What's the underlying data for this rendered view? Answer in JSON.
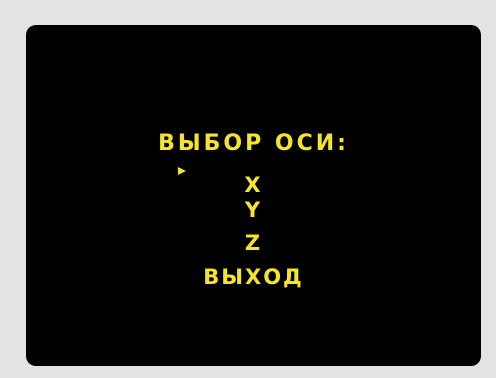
{
  "menu": {
    "title": "ВЫБОР ОСИ:",
    "items": [
      {
        "label": "X",
        "selected": true
      },
      {
        "label": "Y",
        "selected": false
      },
      {
        "label": "Z",
        "selected": false
      },
      {
        "label": "ВЫХОД",
        "selected": false
      }
    ],
    "selector_icon": "triangle-right-icon"
  },
  "colors": {
    "bezel": "#e3e3e3",
    "screen": "#000000",
    "text": "#f5e42c"
  }
}
